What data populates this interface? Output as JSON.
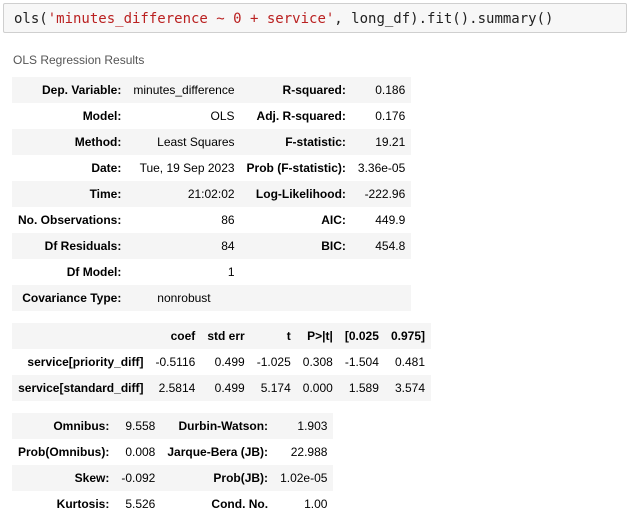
{
  "code": {
    "func": "ols(",
    "formula": "'minutes_difference ~ 0 + service'",
    "rest": ", long_df).fit().summary()"
  },
  "title": "OLS Regression Results",
  "top_table": [
    [
      "Dep. Variable:",
      "minutes_difference",
      "R-squared:",
      "0.186"
    ],
    [
      "Model:",
      "OLS",
      "Adj. R-squared:",
      "0.176"
    ],
    [
      "Method:",
      "Least Squares",
      "F-statistic:",
      "19.21"
    ],
    [
      "Date:",
      "Tue, 19 Sep 2023",
      "Prob (F-statistic):",
      "3.36e-05"
    ],
    [
      "Time:",
      "21:02:02",
      "Log-Likelihood:",
      "-222.96"
    ],
    [
      "No. Observations:",
      "86",
      "AIC:",
      "449.9"
    ],
    [
      "Df Residuals:",
      "84",
      "BIC:",
      "454.8"
    ],
    [
      "Df Model:",
      "1",
      "",
      ""
    ],
    [
      "Covariance Type:",
      "nonrobust",
      "",
      ""
    ]
  ],
  "coef_table": {
    "headers": [
      "",
      "coef",
      "std err",
      "t",
      "P>|t|",
      "[0.025",
      "0.975]"
    ],
    "rows": [
      [
        "service[priority_diff]",
        "-0.5116",
        "0.499",
        "-1.025",
        "0.308",
        "-1.504",
        "0.481"
      ],
      [
        "service[standard_diff]",
        "2.5814",
        "0.499",
        "5.174",
        "0.000",
        "1.589",
        "3.574"
      ]
    ]
  },
  "diag_table": [
    [
      "Omnibus:",
      "9.558",
      "Durbin-Watson:",
      "1.903"
    ],
    [
      "Prob(Omnibus):",
      "0.008",
      "Jarque-Bera (JB):",
      "22.988"
    ],
    [
      "Skew:",
      "-0.092",
      "Prob(JB):",
      "1.02e-05"
    ],
    [
      "Kurtosis:",
      "5.526",
      "Cond. No.",
      "1.00"
    ]
  ]
}
